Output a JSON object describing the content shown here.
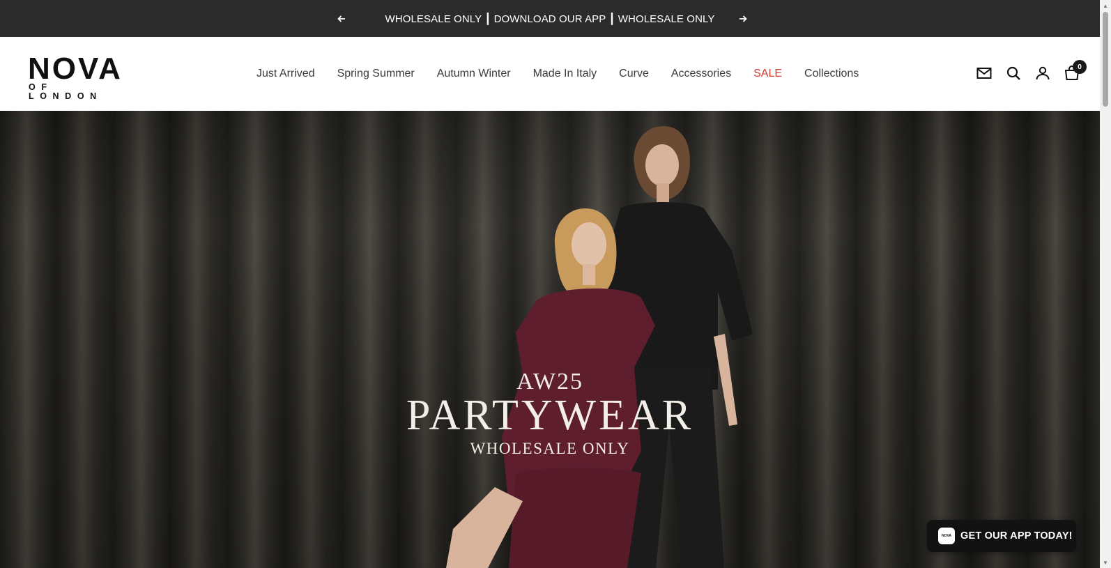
{
  "announcement": {
    "message": "WHOLESALE ONLY ┃ DOWNLOAD OUR APP ┃ WHOLESALE ONLY",
    "prev_icon": "arrow-left-icon",
    "next_icon": "arrow-right-icon"
  },
  "brand": {
    "name": "NOVA",
    "tagline": "OF LONDON"
  },
  "nav": {
    "items": [
      {
        "label": "Just Arrived"
      },
      {
        "label": "Spring Summer"
      },
      {
        "label": "Autumn Winter"
      },
      {
        "label": "Made In Italy"
      },
      {
        "label": "Curve"
      },
      {
        "label": "Accessories"
      },
      {
        "label": "SALE",
        "color": "#d63a2f"
      },
      {
        "label": "Collections"
      }
    ]
  },
  "header_icons": {
    "mail": "mail-icon",
    "search": "search-icon",
    "account": "account-icon",
    "cart": "cart-icon",
    "cart_count": "0"
  },
  "hero": {
    "season": "AW25",
    "title": "PARTYWEAR",
    "subtitle": "WHOLESALE ONLY"
  },
  "app_promo": {
    "label": "GET OUR APP TODAY!",
    "logo_text": "NOVA"
  },
  "colors": {
    "announcement_bg": "#2b2b2b",
    "sale": "#d63a2f",
    "app_button_bg": "#121212"
  }
}
